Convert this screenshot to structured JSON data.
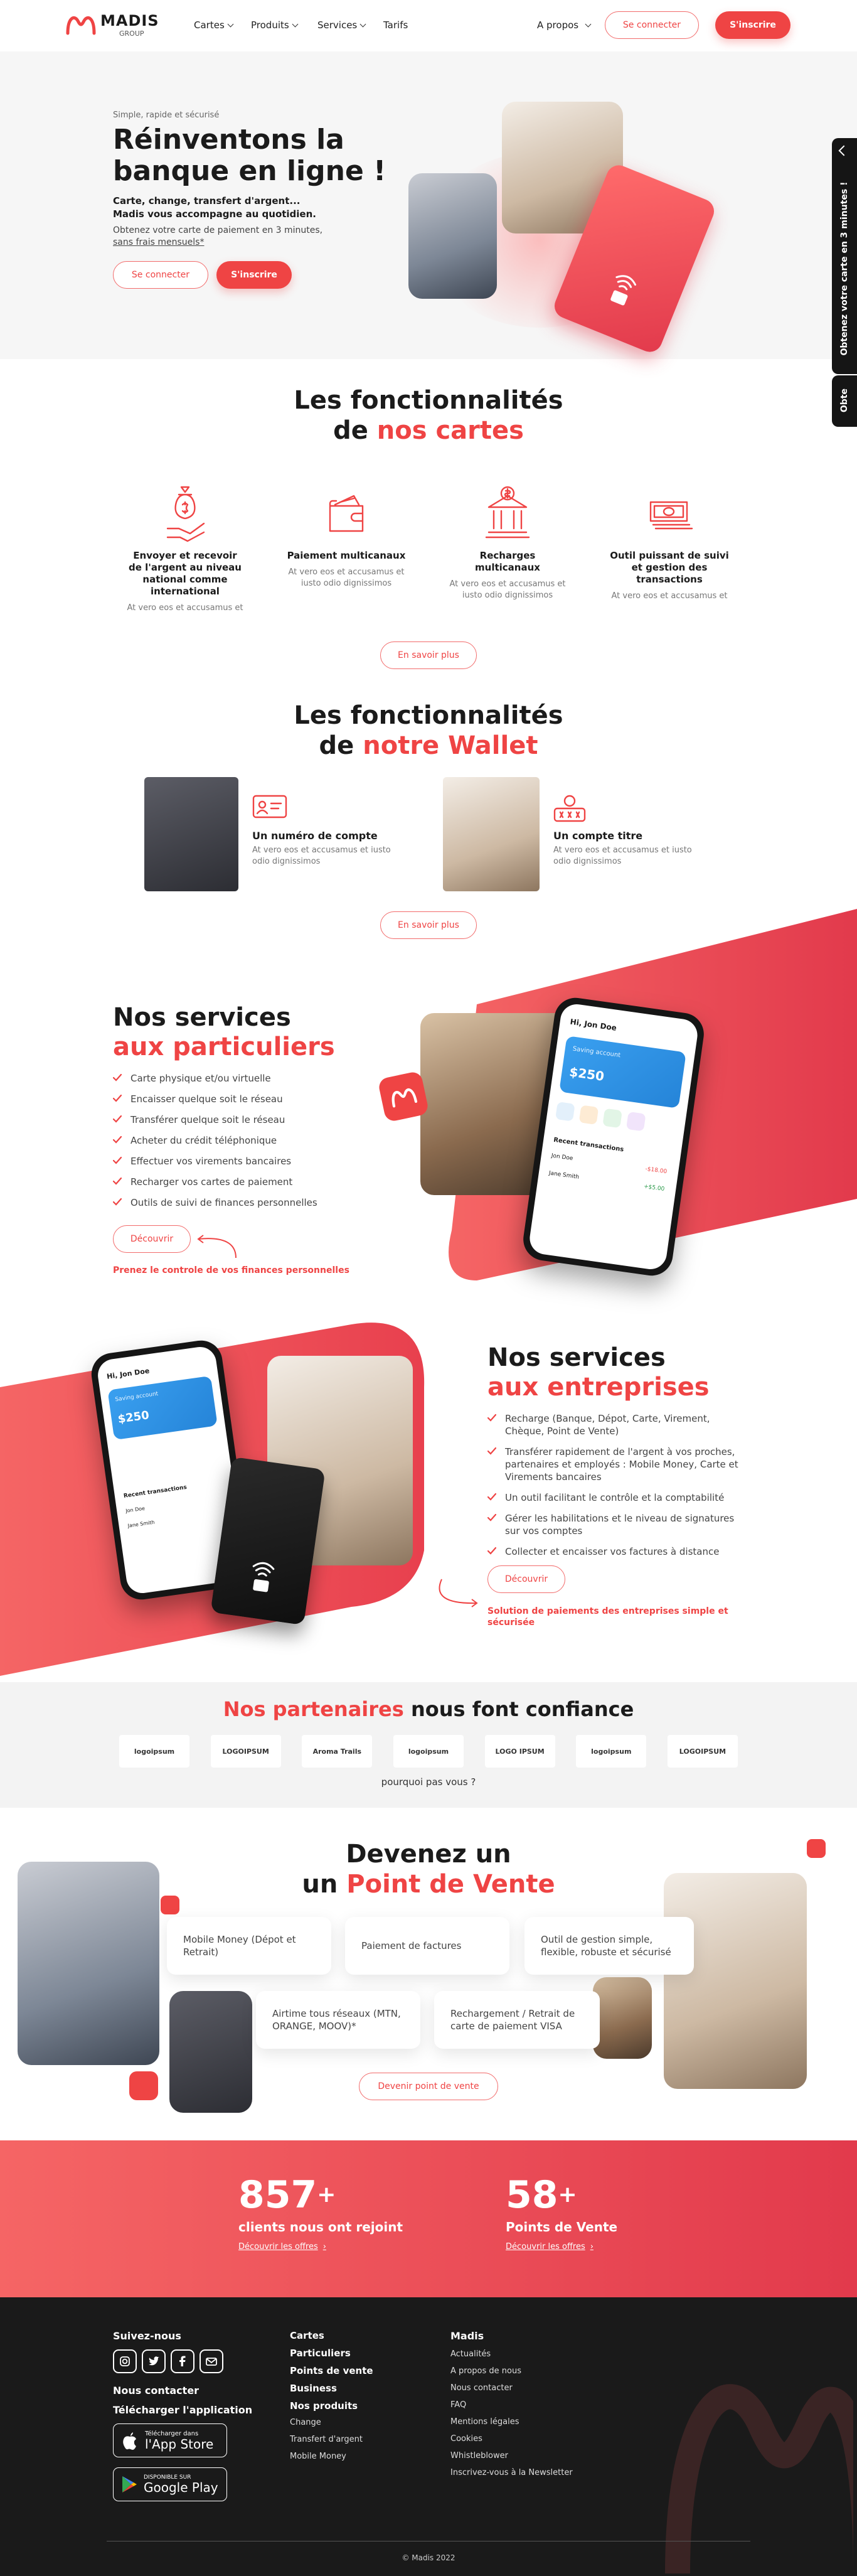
{
  "header": {
    "logo_name": "MADIS",
    "logo_sub": "GROUP",
    "nav": [
      "Cartes",
      "Produits",
      "Services",
      "Tarifs"
    ],
    "about": "A propos",
    "login": "Se connecter",
    "signup": "S'inscrire"
  },
  "side_tab": {
    "label": "Obtenez votre carte en 3 minutes !",
    "label2": "Obte"
  },
  "hero": {
    "eyebrow": "Simple, rapide et sécurisé",
    "title_line1": "Réinventons la",
    "title_line2": "banque en ligne !",
    "subtitle_line1": "Carte, change, transfert d'argent...",
    "subtitle_line2": "Madis vous accompagne au quotidien.",
    "text": "Obtenez votre carte de paiement en 3 minutes,",
    "text_link": "sans frais mensuels*",
    "login": "Se connecter",
    "signup": "S'inscrire"
  },
  "cards_features": {
    "title_line1": "Les fonctionnalités",
    "title_prefix": "de ",
    "title_accent": "nos cartes",
    "items": [
      {
        "icon": "money-bag-hand-icon",
        "title": "Envoyer et recevoir de l'argent au niveau national comme international",
        "text": "At vero eos et accusamus et"
      },
      {
        "icon": "wallet-card-icon",
        "title": "Paiement multicanaux",
        "text": "At vero eos et accusamus et iusto odio dignissimos"
      },
      {
        "icon": "bank-icon",
        "title": "Recharges multicanaux",
        "text": "At vero eos et accusamus et iusto odio dignissimos"
      },
      {
        "icon": "cash-stack-icon",
        "title": "Outil puissant de suivi et gestion des transactions",
        "text": "At vero eos et accusamus et"
      }
    ],
    "more": "En savoir plus"
  },
  "wallet_features": {
    "title_line1": "Les fonctionnalités",
    "title_prefix": "de ",
    "title_accent": "notre Wallet",
    "items": [
      {
        "icon": "id-card-icon",
        "title": "Un numéro de compte",
        "text": "At vero eos et accusamus et iusto odio dignissimos"
      },
      {
        "icon": "password-icon",
        "title": "Un compte titre",
        "text": "At vero eos et accusamus et iusto odio dignissimos"
      }
    ],
    "more": "En savoir plus"
  },
  "individuals": {
    "title_line1": "Nos services",
    "title_line2": "aux particuliers",
    "items": [
      "Carte physique et/ou virtuelle",
      "Encaisser quelque soit le réseau",
      "Transférer quelque soit le réseau",
      "Acheter du crédit téléphonique",
      "Effectuer vos virements bancaires",
      "Recharger vos cartes de paiement",
      "Outils de suivi de finances personnelles"
    ],
    "cta": "Découvrir",
    "tagline": "Prenez le controle de vos finances personnelles"
  },
  "business": {
    "title_line1": "Nos services",
    "title_line2": "aux entreprises",
    "items": [
      "Recharge (Banque, Dépot, Carte, Virement, Chèque, Point de Vente)",
      "Transférer rapidement de l'argent à vos proches, partenaires et employés : Mobile Money, Carte et Virements bancaires",
      "Un outil facilitant le contrôle et la comptabilité",
      "Gérer les habilitations et le niveau de signatures sur vos comptes",
      "Collecter et encaisser vos factures à distance"
    ],
    "cta": "Découvrir",
    "tagline": "Solution de paiements des entreprises simple et sécurisée"
  },
  "app": {
    "greeting": "Hi, Jon Doe",
    "account": "Saving account",
    "balance": "$250",
    "section": "Recent transactions",
    "tx": [
      {
        "name": "Jon Doe",
        "amount": "-$18.00"
      },
      {
        "name": "Jane Smith",
        "amount": "+$5.00"
      }
    ]
  },
  "partners": {
    "title_accent": "Nos partenaires",
    "title_rest": " nous font confiance",
    "logos": [
      "logoipsum",
      "LOGOIPSUM",
      "Aroma Trails",
      "logoipsum",
      "LOGO IPSUM",
      "logoipsum",
      "LOGOIPSUM"
    ],
    "why": "pourquoi pas vous ?"
  },
  "pos": {
    "title_line1": "Devenez un",
    "title_prefix": "un ",
    "title_accent": "Point de Vente",
    "cards": [
      "Mobile Money (Dépot et Retrait)",
      "Paiement de factures",
      "Outil de gestion simple, flexible, robuste et sécurisé",
      "Airtime tous réseaux (MTN, ORANGE, MOOV)*",
      "Rechargement / Retrait de carte de paiement VISA"
    ],
    "cta": "Devenir point de vente"
  },
  "stats": [
    {
      "value": "857",
      "plus": "+",
      "label": "clients nous ont rejoint",
      "link": "Découvrir les offres"
    },
    {
      "value": "58",
      "plus": "+",
      "label": "Points de Vente",
      "link": "Découvrir les offres"
    }
  ],
  "footer": {
    "follow": "Suivez-nous",
    "contact": "Nous contacter",
    "download": "Télécharger l'application",
    "appstore_small": "Télécharger dans",
    "appstore": "l'App Store",
    "play_small": "DISPONIBLE SUR",
    "play": "Google Play",
    "col2": [
      "Cartes",
      "Particuliers",
      "Points de vente",
      "Business",
      "Nos produits"
    ],
    "col2_small": [
      "Change",
      "Transfert d'argent",
      "Mobile Money"
    ],
    "col3_head": "Madis",
    "col3": [
      "Actualités",
      "A propos de nous",
      "Nous contacter",
      "FAQ",
      "Mentions légales",
      "Cookies",
      "Whistleblower",
      "Inscrivez-vous à la Newsletter"
    ],
    "copyright": "© Madis 2022"
  },
  "colors": {
    "accent": "#ef4444",
    "dark": "#1a1a1a"
  }
}
